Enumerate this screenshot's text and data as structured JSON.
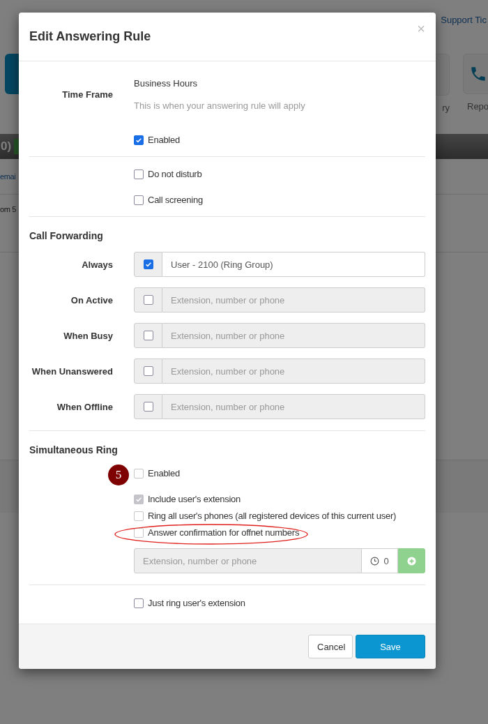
{
  "background": {
    "link": "Support Tic",
    "tiles": [
      {
        "label": "ry"
      },
      {
        "label": "Repo"
      }
    ],
    "bar_text": "0)",
    "rows": [
      "emai",
      "om 5"
    ]
  },
  "dialog": {
    "title": "Edit Answering Rule",
    "close": "×",
    "time_frame": {
      "label": "Time Frame",
      "value": "Business Hours",
      "help": "This is when your answering rule will apply"
    },
    "rule_enabled": {
      "label": "Enabled",
      "checked": true
    },
    "options": [
      {
        "label": "Do not disturb",
        "checked": false
      },
      {
        "label": "Call screening",
        "checked": false
      }
    ],
    "call_forwarding": {
      "title": "Call Forwarding",
      "rows": [
        {
          "label": "Always",
          "checked": true,
          "disabled": false,
          "value": "User - 2100 (Ring Group)"
        },
        {
          "label": "On Active",
          "checked": false,
          "disabled": true,
          "placeholder": "Extension, number or phone"
        },
        {
          "label": "When Busy",
          "checked": false,
          "disabled": true,
          "placeholder": "Extension, number or phone"
        },
        {
          "label": "When Unanswered",
          "checked": false,
          "disabled": true,
          "placeholder": "Extension, number or phone"
        },
        {
          "label": "When Offline",
          "checked": false,
          "disabled": true,
          "placeholder": "Extension, number or phone"
        }
      ]
    },
    "simultaneous_ring": {
      "title": "Simultaneous Ring",
      "step_badge": "5",
      "enabled": {
        "label": "Enabled",
        "checked": false
      },
      "options": [
        {
          "label": "Include user's extension",
          "checked": true,
          "disabled": true,
          "highlighted": false
        },
        {
          "label": "Ring all user's phones (all registered devices of this current user)",
          "checked": false,
          "disabled": true,
          "highlighted": false
        },
        {
          "label": "Answer confirmation for offnet numbers",
          "checked": false,
          "disabled": true,
          "highlighted": true
        }
      ],
      "number_field": {
        "placeholder": "Extension, number or phone",
        "delay": "0",
        "disabled": true
      },
      "just_ring": {
        "label": "Just ring user's extension",
        "checked": false
      }
    },
    "buttons": [
      {
        "label": "Cancel",
        "kind": "secondary"
      },
      {
        "label": "Save",
        "kind": "primary"
      }
    ]
  }
}
